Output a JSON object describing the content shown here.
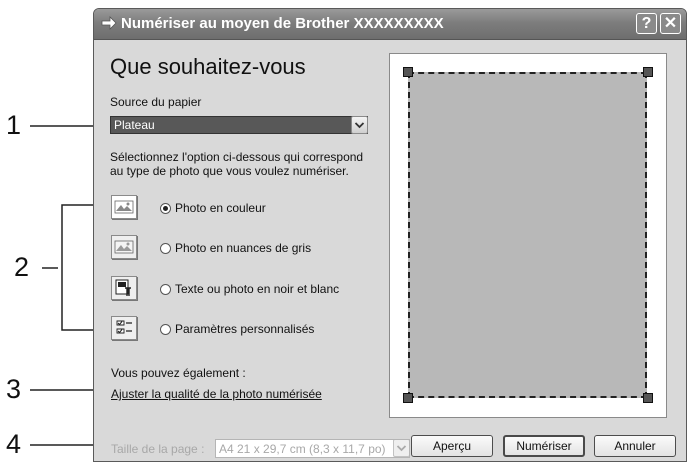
{
  "callouts": [
    "1",
    "2",
    "3",
    "4"
  ],
  "window": {
    "title": "Numériser au moyen de Brother XXXXXXXXX",
    "help_label": "?",
    "close_label": "✕"
  },
  "main": {
    "heading": "Que souhaitez-vous",
    "paper_source_label": "Source du papier",
    "paper_source_value": "Plateau",
    "instruction_line1": "Sélectionnez l'option ci-dessous qui correspond",
    "instruction_line2": "au type de photo que vous voulez numériser.",
    "options": [
      {
        "label": "Photo en couleur",
        "selected": true,
        "icon": "color-photo-icon"
      },
      {
        "label": "Photo en nuances de gris",
        "selected": false,
        "icon": "grayscale-photo-icon"
      },
      {
        "label": "Texte ou photo en noir et blanc",
        "selected": false,
        "icon": "bw-text-photo-icon"
      },
      {
        "label": "Paramètres personnalisés",
        "selected": false,
        "icon": "custom-settings-icon"
      }
    ],
    "also_label": "Vous pouvez également :",
    "adjust_link": "Ajuster la qualité de la photo numérisée"
  },
  "footer": {
    "page_size_label": "Taille de la page :",
    "page_size_value": "A4 21 x 29,7 cm (8,3 x 11,7 po)",
    "preview_button": "Aperçu",
    "scan_button": "Numériser",
    "cancel_button": "Annuler"
  },
  "colors": {
    "titlebar": "#7d7d7d",
    "dialog_bg": "#d9d9d9",
    "preview_area": "#b8b8b8"
  }
}
